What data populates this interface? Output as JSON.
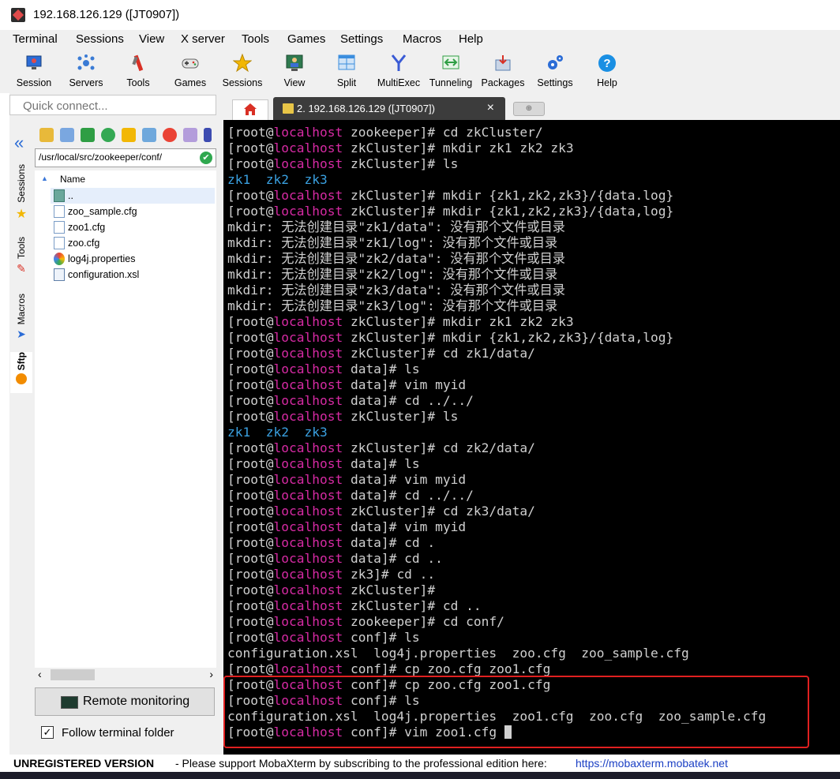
{
  "window": {
    "title": "192.168.126.129 ([JT0907])"
  },
  "menu": [
    "Terminal",
    "Sessions",
    "View",
    "X server",
    "Tools",
    "Games",
    "Settings",
    "Macros",
    "Help"
  ],
  "toolbar": [
    {
      "label": "Session",
      "icon": "session-monitor-icon",
      "color": "#2b6cd6"
    },
    {
      "label": "Servers",
      "icon": "servers-network-icon",
      "color": "#3a7bd5"
    },
    {
      "label": "Tools",
      "icon": "tools-icon",
      "color": "#d93025"
    },
    {
      "label": "Games",
      "icon": "gamepad-icon",
      "color": "#555555"
    },
    {
      "label": "Sessions",
      "icon": "star-icon",
      "color": "#f2b705"
    },
    {
      "label": "View",
      "icon": "view-user-icon",
      "color": "#2f7a4f"
    },
    {
      "label": "Split",
      "icon": "split-window-icon",
      "color": "#3b8ede"
    },
    {
      "label": "MultiExec",
      "icon": "multiexec-fork-icon",
      "color": "#3a5bd5"
    },
    {
      "label": "Tunneling",
      "icon": "tunneling-icon",
      "color": "#2f9e44"
    },
    {
      "label": "Packages",
      "icon": "packages-icon",
      "color": "#5a7fb0"
    },
    {
      "label": "Settings",
      "icon": "settings-gears-icon",
      "color": "#2b6cd6"
    },
    {
      "label": "Help",
      "icon": "help-question-icon",
      "color": "#1a8fe3"
    }
  ],
  "quick_connect": {
    "placeholder": "Quick connect..."
  },
  "side_tabs": [
    {
      "label": "Sessions",
      "icon": "star-icon"
    },
    {
      "label": "Tools",
      "icon": "tools-icon"
    },
    {
      "label": "Macros",
      "icon": "macros-arrow-icon"
    },
    {
      "label": "Sftp",
      "icon": "sftp-icon",
      "active": true
    }
  ],
  "sftp": {
    "path": "/usr/local/src/zookeeper/conf/",
    "column_name": "Name",
    "files": [
      {
        "name": "..",
        "icon": "parent-folder-icon"
      },
      {
        "name": "zoo_sample.cfg",
        "icon": "cfg-file-icon"
      },
      {
        "name": "zoo1.cfg",
        "icon": "cfg-file-icon"
      },
      {
        "name": "zoo.cfg",
        "icon": "cfg-file-icon"
      },
      {
        "name": "log4j.properties",
        "icon": "properties-file-icon"
      },
      {
        "name": "configuration.xsl",
        "icon": "xsl-file-icon"
      }
    ],
    "remote_monitoring": "Remote monitoring",
    "follow_terminal": "Follow terminal folder",
    "follow_checked": true
  },
  "tabs": {
    "session_title": "2. 192.168.126.129 ([JT0907])"
  },
  "terminal": {
    "lines": [
      {
        "type": "prompt",
        "user": "[root@",
        "host": "localhost",
        "cwd": " zookeeper]# ",
        "cmd": "cd zkCluster/"
      },
      {
        "type": "prompt",
        "user": "[root@",
        "host": "localhost",
        "cwd": " zkCluster]# ",
        "cmd": "mkdir zk1 zk2 zk3"
      },
      {
        "type": "prompt",
        "user": "[root@",
        "host": "localhost",
        "cwd": " zkCluster]# ",
        "cmd": "ls"
      },
      {
        "type": "dirs",
        "text": "zk1  zk2  zk3"
      },
      {
        "type": "prompt",
        "user": "[root@",
        "host": "localhost",
        "cwd": " zkCluster]# ",
        "cmd": "mkdir {zk1,zk2,zk3}/{data.log}"
      },
      {
        "type": "prompt",
        "user": "[root@",
        "host": "localhost",
        "cwd": " zkCluster]# ",
        "cmd": "mkdir {zk1,zk2,zk3}/{data,log}"
      },
      {
        "type": "out",
        "text": "mkdir: 无法创建目录\"zk1/data\": 没有那个文件或目录"
      },
      {
        "type": "out",
        "text": "mkdir: 无法创建目录\"zk1/log\": 没有那个文件或目录"
      },
      {
        "type": "out",
        "text": "mkdir: 无法创建目录\"zk2/data\": 没有那个文件或目录"
      },
      {
        "type": "out",
        "text": "mkdir: 无法创建目录\"zk2/log\": 没有那个文件或目录"
      },
      {
        "type": "out",
        "text": "mkdir: 无法创建目录\"zk3/data\": 没有那个文件或目录"
      },
      {
        "type": "out",
        "text": "mkdir: 无法创建目录\"zk3/log\": 没有那个文件或目录"
      },
      {
        "type": "prompt",
        "user": "[root@",
        "host": "localhost",
        "cwd": " zkCluster]# ",
        "cmd": "mkdir zk1 zk2 zk3"
      },
      {
        "type": "prompt",
        "user": "[root@",
        "host": "localhost",
        "cwd": " zkCluster]# ",
        "cmd": "mkdir {zk1,zk2,zk3}/{data,log}"
      },
      {
        "type": "prompt",
        "user": "[root@",
        "host": "localhost",
        "cwd": " zkCluster]# ",
        "cmd": "cd zk1/data/"
      },
      {
        "type": "prompt",
        "user": "[root@",
        "host": "localhost",
        "cwd": " data]# ",
        "cmd": "ls"
      },
      {
        "type": "prompt",
        "user": "[root@",
        "host": "localhost",
        "cwd": " data]# ",
        "cmd": "vim myid"
      },
      {
        "type": "prompt",
        "user": "[root@",
        "host": "localhost",
        "cwd": " data]# ",
        "cmd": "cd ../../"
      },
      {
        "type": "prompt",
        "user": "[root@",
        "host": "localhost",
        "cwd": " zkCluster]# ",
        "cmd": "ls"
      },
      {
        "type": "dirs",
        "text": "zk1  zk2  zk3"
      },
      {
        "type": "prompt",
        "user": "[root@",
        "host": "localhost",
        "cwd": " zkCluster]# ",
        "cmd": "cd zk2/data/"
      },
      {
        "type": "prompt",
        "user": "[root@",
        "host": "localhost",
        "cwd": " data]# ",
        "cmd": "ls"
      },
      {
        "type": "prompt",
        "user": "[root@",
        "host": "localhost",
        "cwd": " data]# ",
        "cmd": "vim myid"
      },
      {
        "type": "prompt",
        "user": "[root@",
        "host": "localhost",
        "cwd": " data]# ",
        "cmd": "cd ../../"
      },
      {
        "type": "prompt",
        "user": "[root@",
        "host": "localhost",
        "cwd": " zkCluster]# ",
        "cmd": "cd zk3/data/"
      },
      {
        "type": "prompt",
        "user": "[root@",
        "host": "localhost",
        "cwd": " data]# ",
        "cmd": "vim myid"
      },
      {
        "type": "prompt",
        "user": "[root@",
        "host": "localhost",
        "cwd": " data]# ",
        "cmd": "cd ."
      },
      {
        "type": "prompt",
        "user": "[root@",
        "host": "localhost",
        "cwd": " data]# ",
        "cmd": "cd .."
      },
      {
        "type": "prompt",
        "user": "[root@",
        "host": "localhost",
        "cwd": " zk3]# ",
        "cmd": "cd .."
      },
      {
        "type": "prompt",
        "user": "[root@",
        "host": "localhost",
        "cwd": " zkCluster]# ",
        "cmd": ""
      },
      {
        "type": "prompt",
        "user": "[root@",
        "host": "localhost",
        "cwd": " zkCluster]# ",
        "cmd": "cd .."
      },
      {
        "type": "prompt",
        "user": "[root@",
        "host": "localhost",
        "cwd": " zookeeper]# ",
        "cmd": "cd conf/"
      },
      {
        "type": "prompt",
        "user": "[root@",
        "host": "localhost",
        "cwd": " conf]# ",
        "cmd": "ls"
      },
      {
        "type": "out",
        "text": "configuration.xsl  log4j.properties  zoo.cfg  zoo_sample.cfg"
      },
      {
        "type": "prompt",
        "user": "[root@",
        "host": "localhost",
        "cwd": " conf]# ",
        "cmd": "cp zoo.cfg zoo1.cfg"
      },
      {
        "type": "prompt",
        "user": "[root@",
        "host": "localhost",
        "cwd": " conf]# ",
        "cmd": "cp zoo.cfg zoo1.cfg"
      },
      {
        "type": "prompt",
        "user": "[root@",
        "host": "localhost",
        "cwd": " conf]# ",
        "cmd": "ls"
      },
      {
        "type": "out",
        "text": "configuration.xsl  log4j.properties  zoo1.cfg  zoo.cfg  zoo_sample.cfg"
      },
      {
        "type": "prompt",
        "user": "[root@",
        "host": "localhost",
        "cwd": " conf]# ",
        "cmd": "vim zoo1.cfg ",
        "cursor": true
      }
    ]
  },
  "status": {
    "unregistered": "UNREGISTERED VERSION",
    "message": " -  Please support MobaXterm by subscribing to the professional edition here:",
    "link": "https://mobaxterm.mobatek.net"
  },
  "colors": {
    "terminal_bg": "#000000",
    "terminal_fg": "#d0d0d0",
    "hostname": "#d62aa3",
    "dir_listing": "#3aa0e0",
    "highlight_box": "#e02020"
  }
}
